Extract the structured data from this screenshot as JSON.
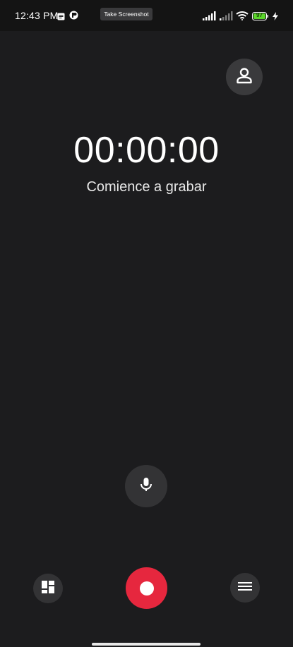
{
  "status_bar": {
    "time": "12:43 PM",
    "screenshot_chip": "Take Screenshot",
    "battery_level": "97",
    "icons": [
      "notes-icon",
      "app-notification-icon",
      "signal-icon",
      "signal-weak-icon",
      "wifi-icon",
      "battery-icon",
      "charging-icon"
    ]
  },
  "recorder": {
    "timer": "00:00:00",
    "hint": "Comience a grabar"
  },
  "buttons": {
    "account_icon": "person-icon",
    "mic_icon": "microphone-icon",
    "files_icon": "grid-icon",
    "record_icon": "record-dot-icon",
    "menu_icon": "menu-icon"
  },
  "colors": {
    "background": "#1c1c1e",
    "record": "#e6273e",
    "button_surface": "#333335",
    "battery_fill": "#5bd62b"
  }
}
